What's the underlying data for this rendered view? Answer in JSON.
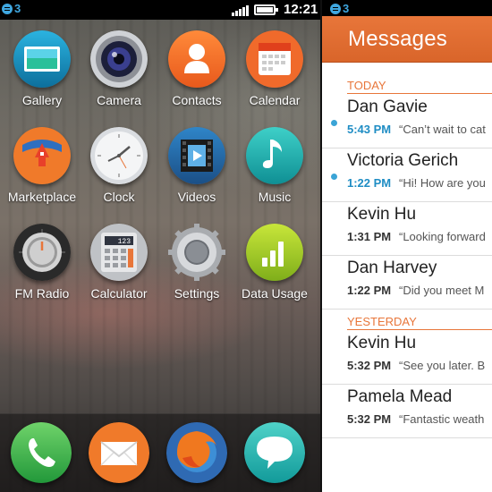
{
  "homescreen": {
    "statusbar": {
      "carrier_label": "3",
      "time": "12:21"
    },
    "apps": [
      {
        "label": "Gallery",
        "icon": "gallery-icon"
      },
      {
        "label": "Camera",
        "icon": "camera-icon"
      },
      {
        "label": "Contacts",
        "icon": "contacts-icon"
      },
      {
        "label": "Calendar",
        "icon": "calendar-icon"
      },
      {
        "label": "Marketplace",
        "icon": "marketplace-icon"
      },
      {
        "label": "Clock",
        "icon": "clock-icon"
      },
      {
        "label": "Videos",
        "icon": "videos-icon"
      },
      {
        "label": "Music",
        "icon": "music-icon"
      },
      {
        "label": "FM Radio",
        "icon": "fm-radio-icon"
      },
      {
        "label": "Calculator",
        "icon": "calculator-icon",
        "display": "123"
      },
      {
        "label": "Settings",
        "icon": "settings-gear-icon"
      },
      {
        "label": "Data Usage",
        "icon": "data-usage-icon"
      }
    ],
    "dock": [
      {
        "icon": "phone-icon"
      },
      {
        "icon": "email-icon"
      },
      {
        "icon": "firefox-browser-icon"
      },
      {
        "icon": "messages-bubble-icon"
      }
    ]
  },
  "messages": {
    "statusbar": {
      "carrier_label": "3"
    },
    "title": "Messages",
    "sections": {
      "today": "TODAY",
      "yesterday": "YESTERDAY"
    },
    "threads": [
      {
        "name": "Dan Gavie",
        "time": "5:43 PM",
        "preview": "“Can’t wait to cat",
        "unread": true
      },
      {
        "name": "Victoria Gerich",
        "time": "1:22 PM",
        "preview": "“Hi! How are you",
        "unread": true
      },
      {
        "name": "Kevin Hu",
        "time": "1:31 PM",
        "preview": "“Looking forward",
        "unread": false
      },
      {
        "name": "Dan Harvey",
        "time": "1:22 PM",
        "preview": "“Did you meet M",
        "unread": false
      },
      {
        "name": "Kevin Hu",
        "time": "5:32 PM",
        "preview": "“See you later. B",
        "unread": false
      },
      {
        "name": "Pamela Mead",
        "time": "5:32 PM",
        "preview": "“Fantastic weath",
        "unread": false
      }
    ]
  },
  "colors": {
    "accent_orange": "#e8763a",
    "unread_blue": "#3aa4d6",
    "carrier_blue": "#3fa7e0"
  }
}
